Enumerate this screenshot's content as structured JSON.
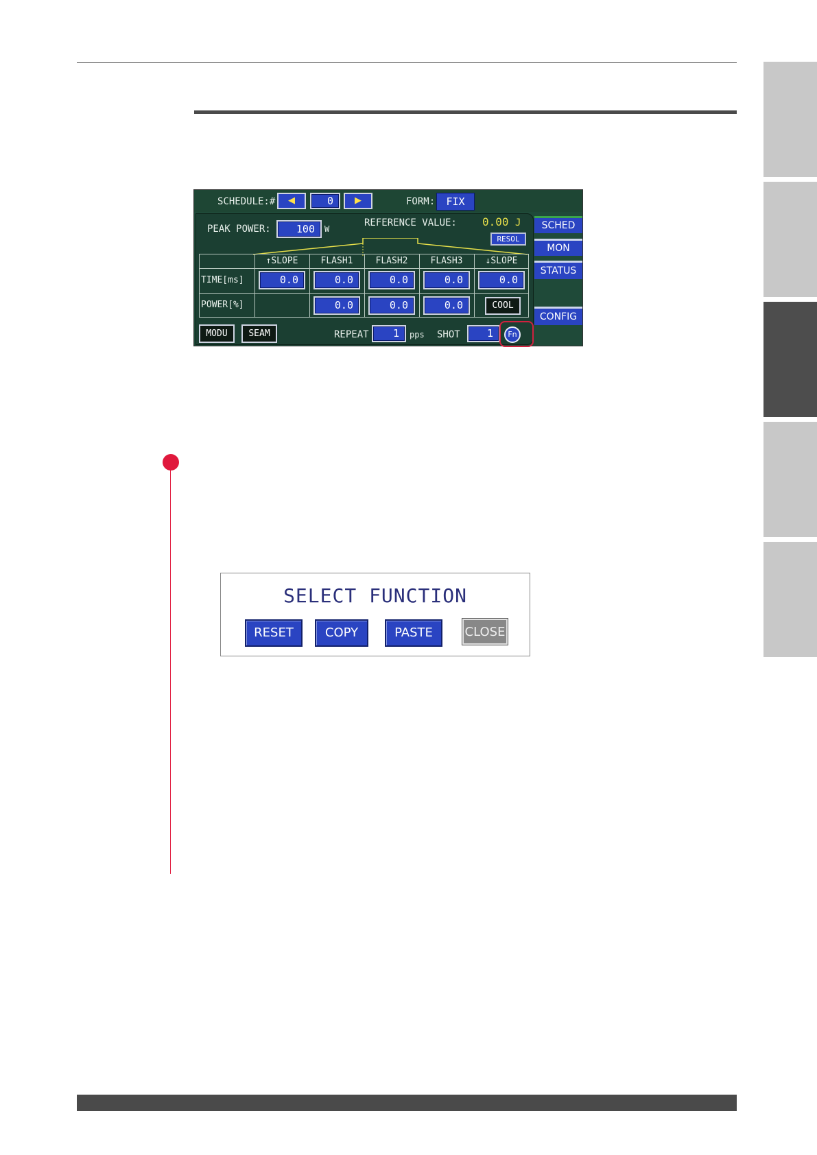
{
  "screen": {
    "schedule_label": "SCHEDULE:#",
    "schedule_value": "0",
    "prev_icon": "left-arrow-icon",
    "next_icon": "right-arrow-icon",
    "form_label": "FORM:",
    "form_value": "FIX",
    "peak_power_label": "PEAK POWER:",
    "peak_power_value": "100",
    "peak_power_unit": "W",
    "reference_label": "REFERENCE VALUE:",
    "reference_value": "0.00",
    "reference_unit": "J",
    "resol_label": "RESOL",
    "columns": [
      "↑SLOPE",
      "FLASH1",
      "FLASH2",
      "FLASH3",
      "↓SLOPE"
    ],
    "time_label": "TIME[ms]",
    "time_values": [
      "0.0",
      "0.0",
      "0.0",
      "0.0",
      "0.0"
    ],
    "power_label": "POWER[%]",
    "power_values": [
      "0.0",
      "0.0",
      "0.0"
    ],
    "cool_label": "COOL",
    "modu_label": "MODU",
    "seam_label": "SEAM",
    "repeat_label": "REPEAT",
    "repeat_value": "1",
    "pps_label": "pps",
    "shot_label": "SHOT",
    "shot_value": "1",
    "fn_label": "Fn",
    "side_menu": [
      "SCHED",
      "MON",
      "STATUS",
      "CONFIG"
    ],
    "accent_color": "#2a44c2",
    "screen_bg": "#1f4a39"
  },
  "dialog": {
    "title": "SELECT FUNCTION",
    "buttons": [
      "RESET",
      "COPY",
      "PASTE",
      "CLOSE"
    ]
  },
  "colors": {
    "step_marker": "#e0183c",
    "active_tab": "#4d4d4d",
    "inactive_tab": "#c8c8c8"
  }
}
